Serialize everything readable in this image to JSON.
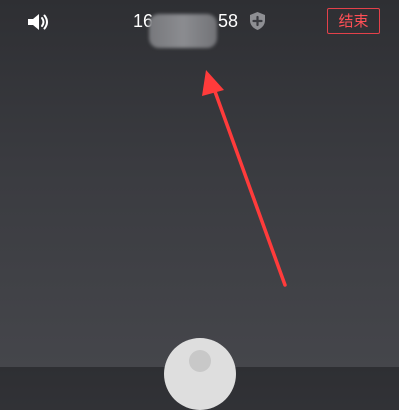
{
  "header": {
    "speaker_icon": "speaker-icon",
    "phone_number": {
      "visible_prefix": "16",
      "visible_suffix": "58",
      "middle_redacted": true
    },
    "secure_icon": "shield-plus-icon",
    "end_label": "结束"
  },
  "annotation": {
    "type": "arrow",
    "color": "#ff3b3b"
  },
  "colors": {
    "background": "#3a3b40",
    "accent": "#ff4f56",
    "text": "#ffffff"
  }
}
